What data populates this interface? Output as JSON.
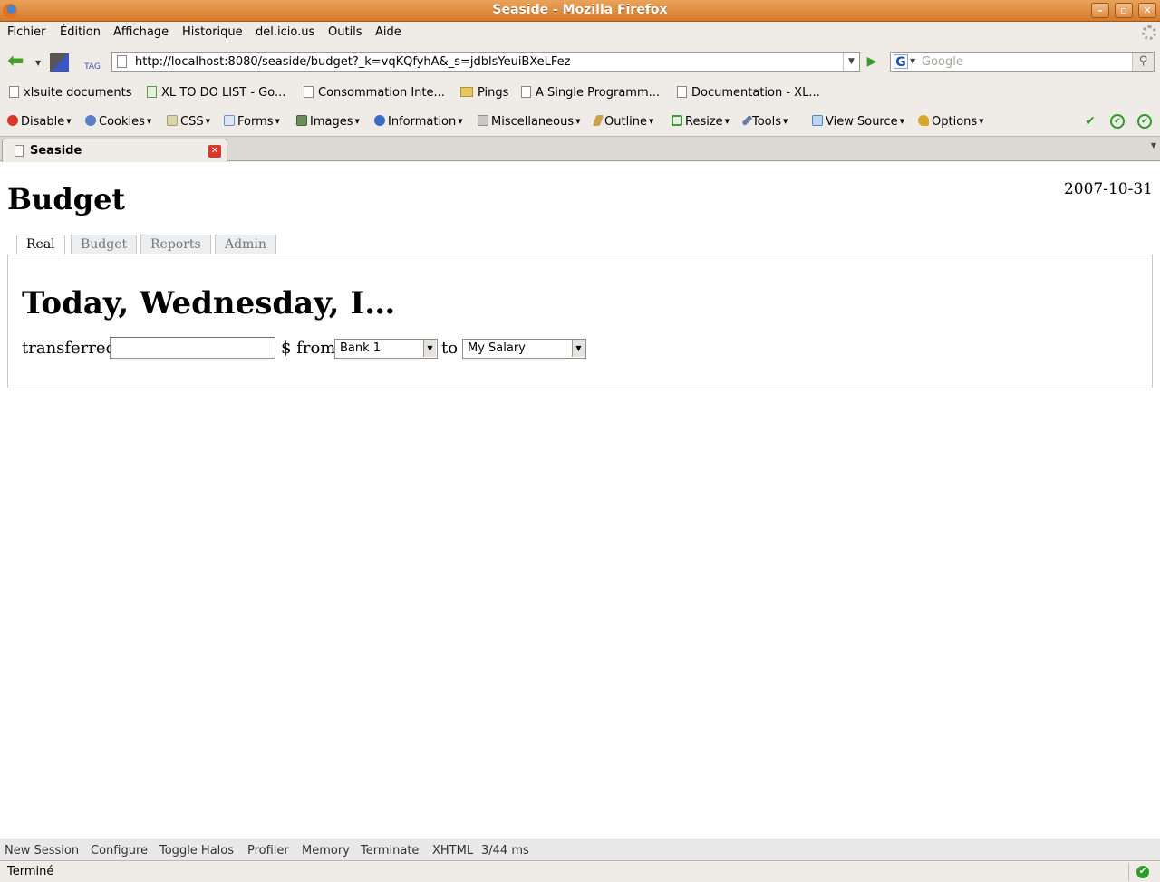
{
  "window": {
    "title": "Seaside - Mozilla Firefox"
  },
  "menu": [
    "Fichier",
    "Édition",
    "Affichage",
    "Historique",
    "del.icio.us",
    "Outils",
    "Aide"
  ],
  "navigation": {
    "url": "http://localhost:8080/seaside/budget?_k=vqKQfyhA&_s=jdblsYeuiBXeLFez",
    "search_placeholder": "Google",
    "search_engine_icon": "G"
  },
  "bookmarks": [
    {
      "label": "xlsuite documents",
      "icon": "page-icon"
    },
    {
      "label": "XL TO DO LIST - Go...",
      "icon": "spreadsheet-icon"
    },
    {
      "label": "Consommation Inte...",
      "icon": "page-icon"
    },
    {
      "label": "Pings",
      "icon": "folder-icon"
    },
    {
      "label": "A Single Programm...",
      "icon": "page-icon"
    },
    {
      "label": "Documentation - XL...",
      "icon": "page-icon"
    }
  ],
  "devtoolbar": [
    {
      "label": "Disable",
      "icon": "disable-icon",
      "color": "#d9372b"
    },
    {
      "label": "Cookies",
      "icon": "cookie-icon",
      "color": "#5a7ec8"
    },
    {
      "label": "CSS",
      "icon": "css-icon",
      "color": "#b9b48a"
    },
    {
      "label": "Forms",
      "icon": "forms-icon",
      "color": "#6b8fc8"
    },
    {
      "label": "Images",
      "icon": "images-icon",
      "color": "#6a8f5a"
    },
    {
      "label": "Information",
      "icon": "info-icon",
      "color": "#3a6bc6"
    },
    {
      "label": "Miscellaneous",
      "icon": "misc-icon",
      "color": "#a8a8a8"
    },
    {
      "label": "Outline",
      "icon": "outline-icon",
      "color": "#c9a24a"
    },
    {
      "label": "Resize",
      "icon": "resize-icon",
      "color": "#3f9a3f"
    },
    {
      "label": "Tools",
      "icon": "tools-icon",
      "color": "#6d7ea6"
    },
    {
      "label": "View Source",
      "icon": "view-source-icon",
      "color": "#4a86c6"
    },
    {
      "label": "Options",
      "icon": "options-icon",
      "color": "#d8a72a"
    }
  ],
  "tab": {
    "title": "Seaside"
  },
  "page": {
    "title": "Budget",
    "date": "2007-10-31",
    "tabs": [
      "Real",
      "Budget",
      "Reports",
      "Admin"
    ],
    "active_tab": "Real",
    "heading": "Today, Wednesday, I…",
    "form": {
      "label_transferred": "transferred",
      "amount_value": "",
      "label_from": "$ from",
      "from_account": "Bank 1",
      "label_to": "to",
      "to_account": "My Salary"
    }
  },
  "seaside_toolbar": [
    "New Session",
    "Configure",
    "Toggle Halos",
    "Profiler",
    "Memory",
    "Terminate",
    "XHTML",
    "3/44 ms"
  ],
  "status": {
    "text": "Terminé"
  }
}
